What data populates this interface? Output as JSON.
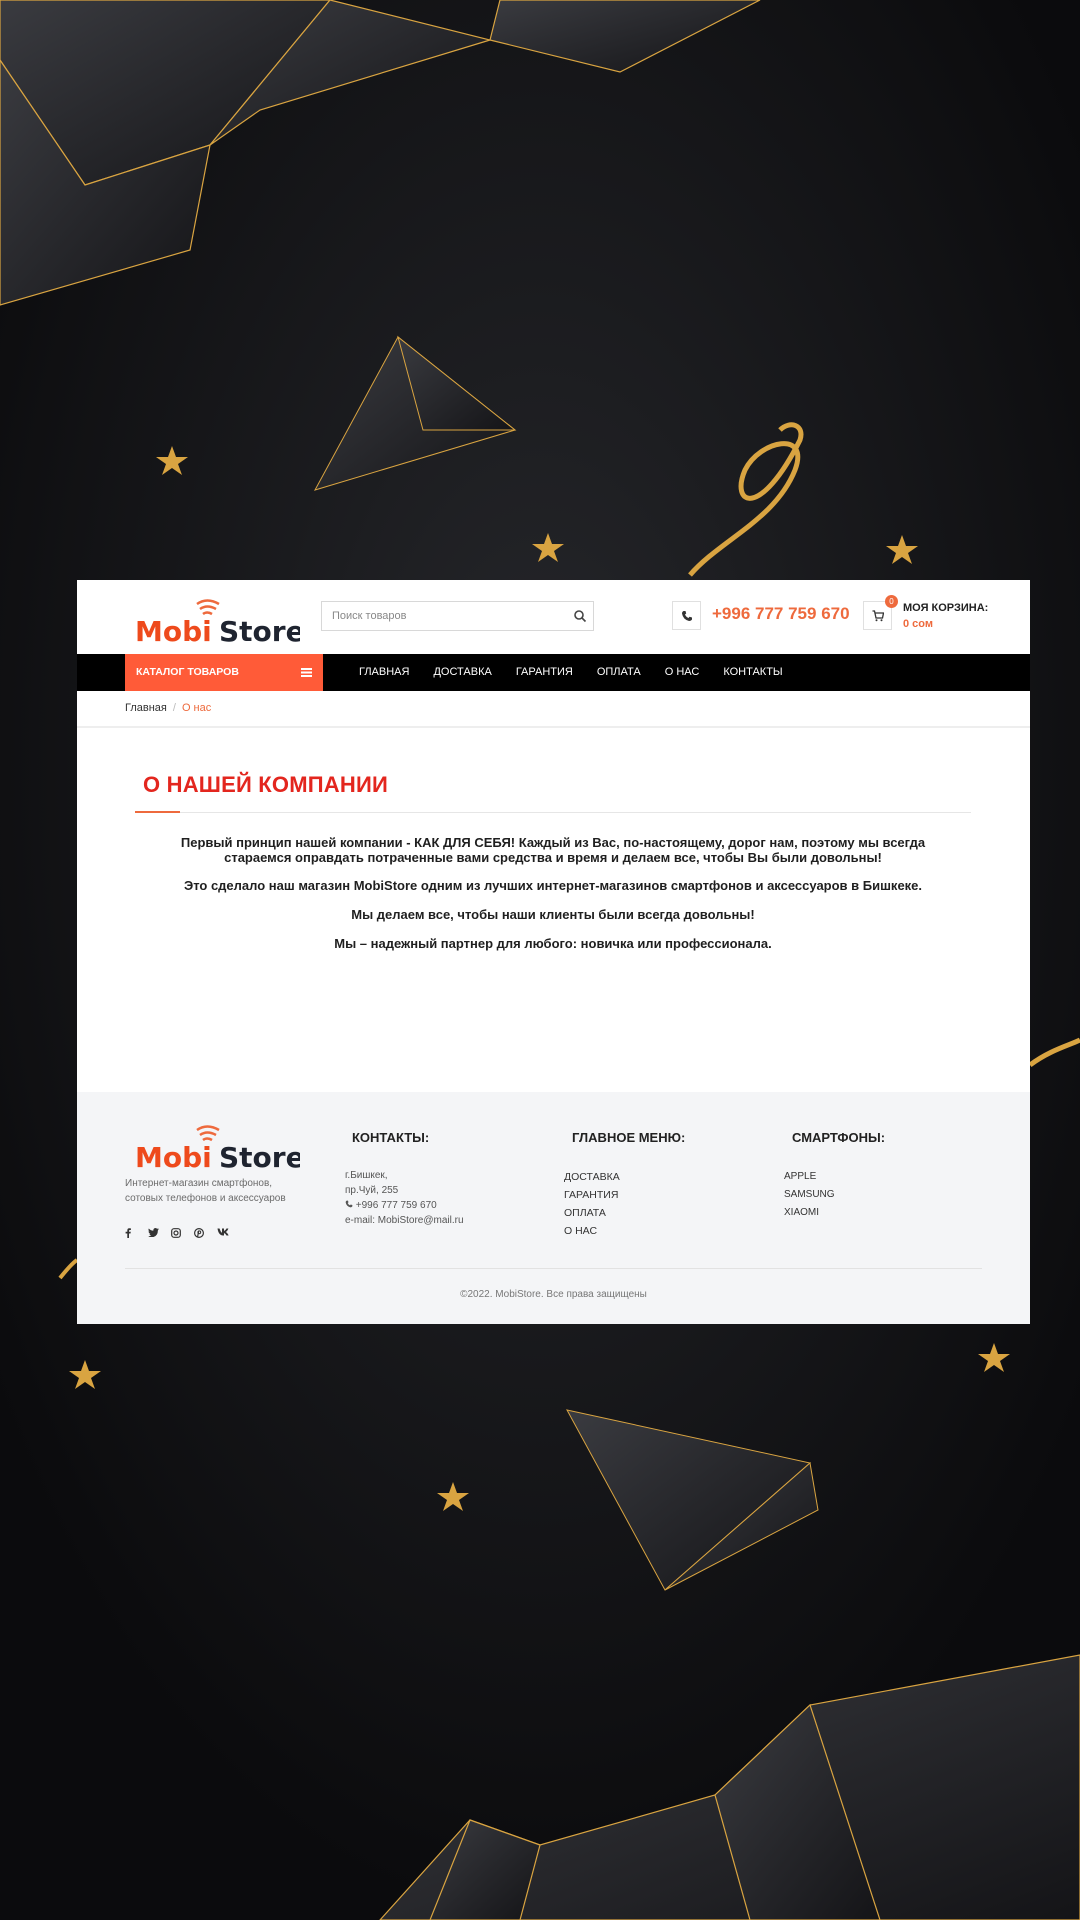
{
  "colors": {
    "accent": "#ee6a3d",
    "catalog_bg": "#ff5b38",
    "heading": "#e3261e",
    "nav_bg": "#000000",
    "page_bg": "#111214",
    "gold": "#d9a441"
  },
  "logo": {
    "part1": "Mobi",
    "part2": "Store"
  },
  "search": {
    "placeholder": "Поиск товаров",
    "icon": "search-icon"
  },
  "header": {
    "phone": "+996 777 759 670",
    "cart_count": "0",
    "cart_title": "МОЯ КОРЗИНА:",
    "cart_sum": "0 сом"
  },
  "nav": {
    "catalog_label": "КАТАЛОГ ТОВАРОВ",
    "items": [
      "ГЛАВНАЯ",
      "ДОСТАВКА",
      "ГАРАНТИЯ",
      "ОПЛАТА",
      "О НАС",
      "КОНТАКТЫ"
    ]
  },
  "breadcrumb": {
    "home": "Главная",
    "sep": "/",
    "current": "О нас"
  },
  "content": {
    "title": "О НАШЕЙ КОМПАНИИ",
    "p1a": "Первый принцип нашей компании - КАК ДЛЯ СЕБЯ! Каждый из Вас, по-настоящему, дорог нам, поэтому мы всегда",
    "p1b": "стараемся оправдать потраченные вами средства и время и делаем все, чтобы Вы были довольны!",
    "p2": "Это сделало наш магазин MobiStore одним из лучших интернет-магазинов смартфонов и аксессуаров в Бишкеке.",
    "p3": "Мы делаем все, чтобы наши клиенты были всегда довольны!",
    "p4": "Мы – надежный партнер для любого: новичка или профессионала."
  },
  "footer": {
    "desc1": "Интернет-магазин смартфонов,",
    "desc2": "сотовых телефонов и аксессуаров",
    "social": [
      "f",
      "twitter-icon",
      "instagram-icon",
      "pinterest-icon",
      "vk"
    ],
    "contacts_title": "КОНТАКТЫ:",
    "city": "г.Бишкек,",
    "street": "пр.Чуй, 255",
    "phone": "+996 777 759 670",
    "email": "e-mail: MobiStore@mail.ru",
    "menu_title": "ГЛАВНОЕ МЕНЮ:",
    "menu": [
      "ДОСТАВКА",
      "ГАРАНТИЯ",
      "ОПЛАТА",
      "О НАС"
    ],
    "phones_title": "СМАРТФОНЫ:",
    "brands": [
      "APPLE",
      "SAMSUNG",
      "XIAOMI"
    ],
    "copyright": "©2022. MobiStore. Все права защищены"
  }
}
